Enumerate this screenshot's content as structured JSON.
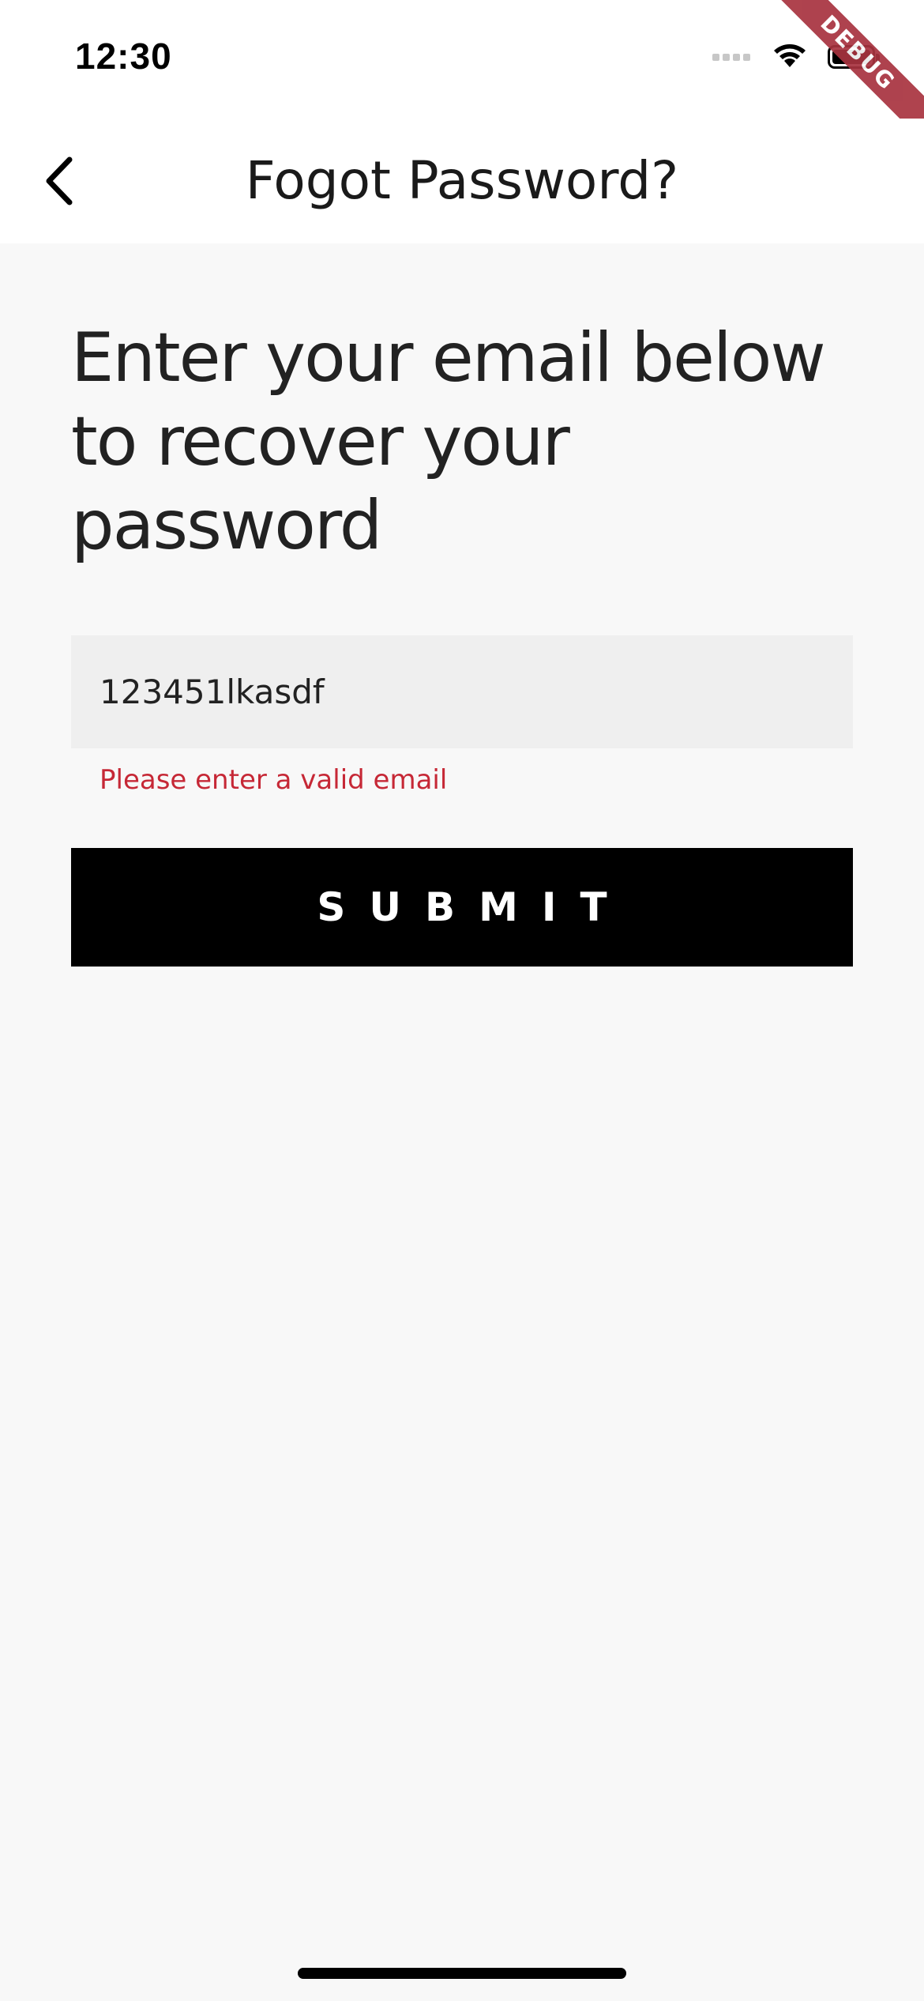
{
  "status_bar": {
    "time": "12:30",
    "signal_icon": "cellular-signal-icon",
    "wifi_icon": "wifi-icon",
    "battery_icon": "battery-icon"
  },
  "debug_banner": {
    "label": "DEBUG",
    "color": "#a8333f"
  },
  "app_bar": {
    "back_icon": "chevron-left-icon",
    "title": "Fogot Password?"
  },
  "main": {
    "headline": "Enter your email below to recover your password",
    "email_field": {
      "value": "123451lkasdf"
    },
    "error_message": "Please enter a valid email",
    "submit_label": "SUBMIT"
  },
  "colors": {
    "background": "#f8f8f8",
    "field_background": "#efefef",
    "error": "#c62836",
    "button": "#000000",
    "button_text": "#ffffff"
  }
}
